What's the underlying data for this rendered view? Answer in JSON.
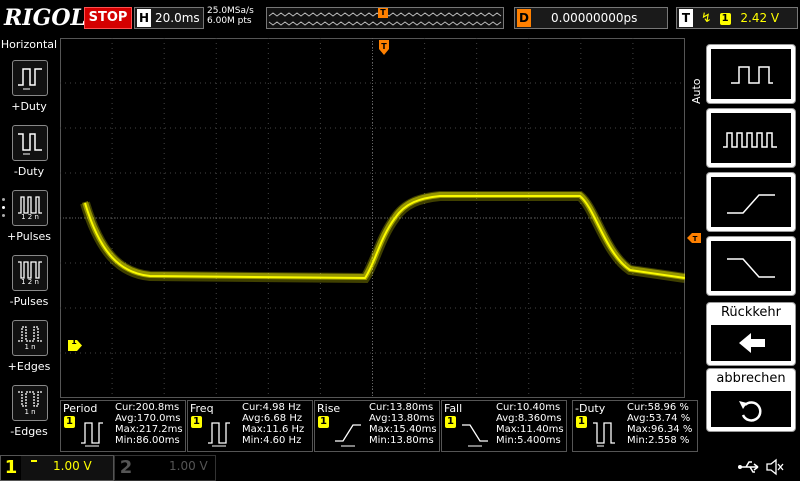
{
  "brand": "RIGOL",
  "run_state": "STOP",
  "timebase": {
    "letter": "H",
    "value": "20.0ms"
  },
  "sampling": {
    "rate": "25.0MSa/s",
    "points": "6.00M pts"
  },
  "trigger_pos_marker": "T",
  "delay": {
    "letter": "D",
    "value": "0.00000000ps"
  },
  "trigger": {
    "letter": "T",
    "channel": "1",
    "level": "2.42 V"
  },
  "left_panel": {
    "title": "Horizontal",
    "items": [
      {
        "label": "+Duty"
      },
      {
        "label": "-Duty"
      },
      {
        "label": "+Pulses",
        "sub": "1 2 n"
      },
      {
        "label": "-Pulses",
        "sub": "1 2 n"
      },
      {
        "label": "+Edges",
        "sub": "1 n"
      },
      {
        "label": "-Edges",
        "sub": "1 n"
      }
    ]
  },
  "right_panel": {
    "auto_label": "Auto",
    "back_label": "Rückkehr",
    "cancel_label": "abbrechen"
  },
  "ch1_marker": "1",
  "measurements": [
    {
      "title": "Period",
      "cur": "Cur:200.8ms",
      "avg": "Avg:170.0ms",
      "max": "Max:217.2ms",
      "min": "Min:86.00ms"
    },
    {
      "title": "Freq",
      "cur": "Cur:4.98 Hz",
      "avg": "Avg:6.68 Hz",
      "max": "Max:11.6 Hz",
      "min": "Min:4.60 Hz"
    },
    {
      "title": "Rise",
      "cur": "Cur:13.80ms",
      "avg": "Avg:13.80ms",
      "max": "Max:15.40ms",
      "min": "Min:13.80ms"
    },
    {
      "title": "Fall",
      "cur": "Cur:10.40ms",
      "avg": "Avg:8.360ms",
      "max": "Max:11.40ms",
      "min": "Min:5.400ms"
    },
    {
      "title": "-Duty",
      "cur": "Cur:58.96 %",
      "avg": "Avg:53.74 %",
      "max": "Max:96.34 %",
      "min": "Min:2.558 %"
    }
  ],
  "channels": [
    {
      "num": "1",
      "scale": "1.00 V"
    },
    {
      "num": "2",
      "scale": "1.00 V"
    }
  ],
  "colors": {
    "ch1": "#ffff00",
    "stop": "#d40000",
    "trigger": "#ff8000",
    "grid": "#404040"
  },
  "icons": {
    "usb": "usb-icon",
    "speaker": "speaker-muted-icon"
  }
}
